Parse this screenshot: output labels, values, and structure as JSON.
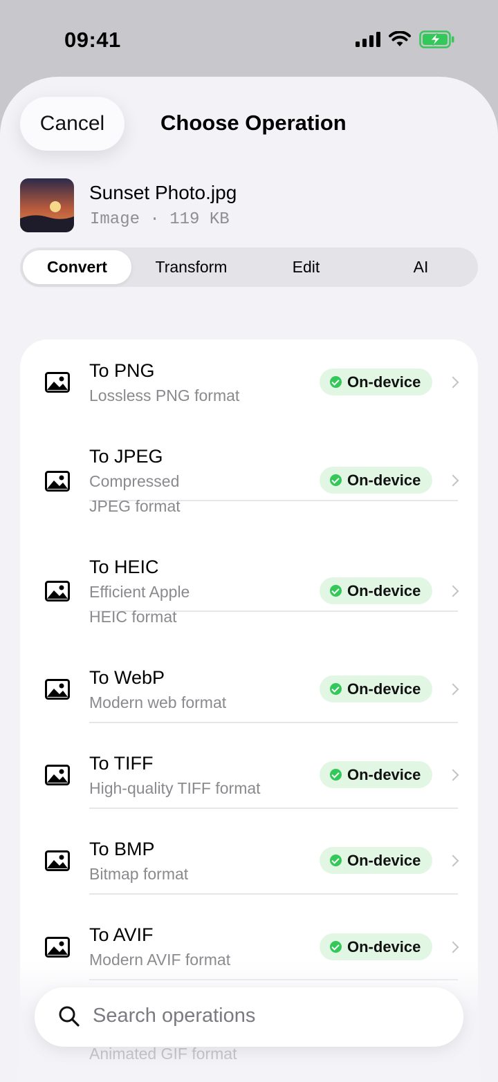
{
  "status_bar": {
    "time": "09:41"
  },
  "header": {
    "cancel_label": "Cancel",
    "title": "Choose Operation"
  },
  "file": {
    "name": "Sunset Photo.jpg",
    "meta": "Image · 119 KB"
  },
  "tabs": [
    {
      "label": "Convert",
      "active": true
    },
    {
      "label": "Transform",
      "active": false
    },
    {
      "label": "Edit",
      "active": false
    },
    {
      "label": "AI",
      "active": false
    }
  ],
  "operations": [
    {
      "title": "To PNG",
      "description": "Lossless PNG format",
      "badge": "On-device",
      "icon": "image-icon"
    },
    {
      "title": "To JPEG",
      "description": "Compressed JPEG format",
      "badge": "On-device",
      "icon": "image-icon"
    },
    {
      "title": "To HEIC",
      "description": "Efficient Apple HEIC format",
      "badge": "On-device",
      "icon": "image-icon"
    },
    {
      "title": "To WebP",
      "description": "Modern web format",
      "badge": "On-device",
      "icon": "image-icon"
    },
    {
      "title": "To TIFF",
      "description": "High-quality TIFF format",
      "badge": "On-device",
      "icon": "image-icon"
    },
    {
      "title": "To BMP",
      "description": "Bitmap format",
      "badge": "On-device",
      "icon": "image-icon"
    },
    {
      "title": "To AVIF",
      "description": "Modern AVIF format",
      "badge": "On-device",
      "icon": "image-icon"
    }
  ],
  "partially_hidden_row": {
    "description": "Animated GIF format"
  },
  "search": {
    "placeholder": "Search operations"
  },
  "colors": {
    "on_device_badge_bg": "#e1f7e4",
    "on_device_dot": "#34c759",
    "sheet_bg": "#f2f2f7"
  }
}
